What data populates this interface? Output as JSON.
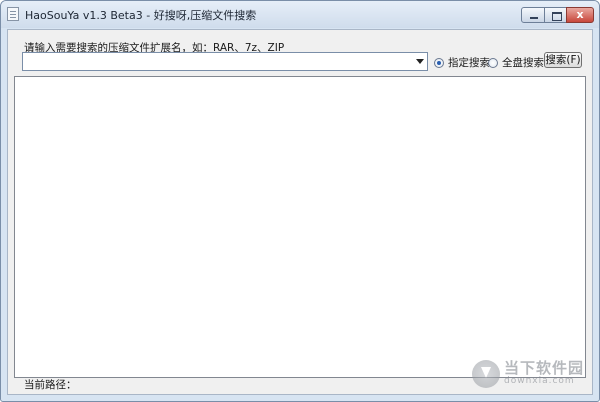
{
  "window": {
    "title": "HaoSouYa v1.3 Beta3 - 好搜呀,压缩文件搜索",
    "close_glyph": "x"
  },
  "search": {
    "prompt": "请输入需要搜索的压缩文件扩展名，如：RAR、7z、ZIP",
    "value": "",
    "placeholder": ""
  },
  "scope": {
    "option_specified": "指定搜索",
    "option_full_disk": "全盘搜索",
    "selected": "指定搜索"
  },
  "buttons": {
    "search": "搜索(F)"
  },
  "status": {
    "current_path_label": "当前路径："
  },
  "watermark": {
    "cn": "当下软件园",
    "en": "downxia.com"
  },
  "icons": {
    "app": "app-document-icon",
    "dropdown": "chevron-down-icon",
    "watermark": "download-arrow-icon"
  },
  "colors": {
    "titlebar": "#cfdcec",
    "client": "#f0f0f0",
    "close_button": "#c8473b",
    "radio_selected": "#2a5fb0"
  }
}
